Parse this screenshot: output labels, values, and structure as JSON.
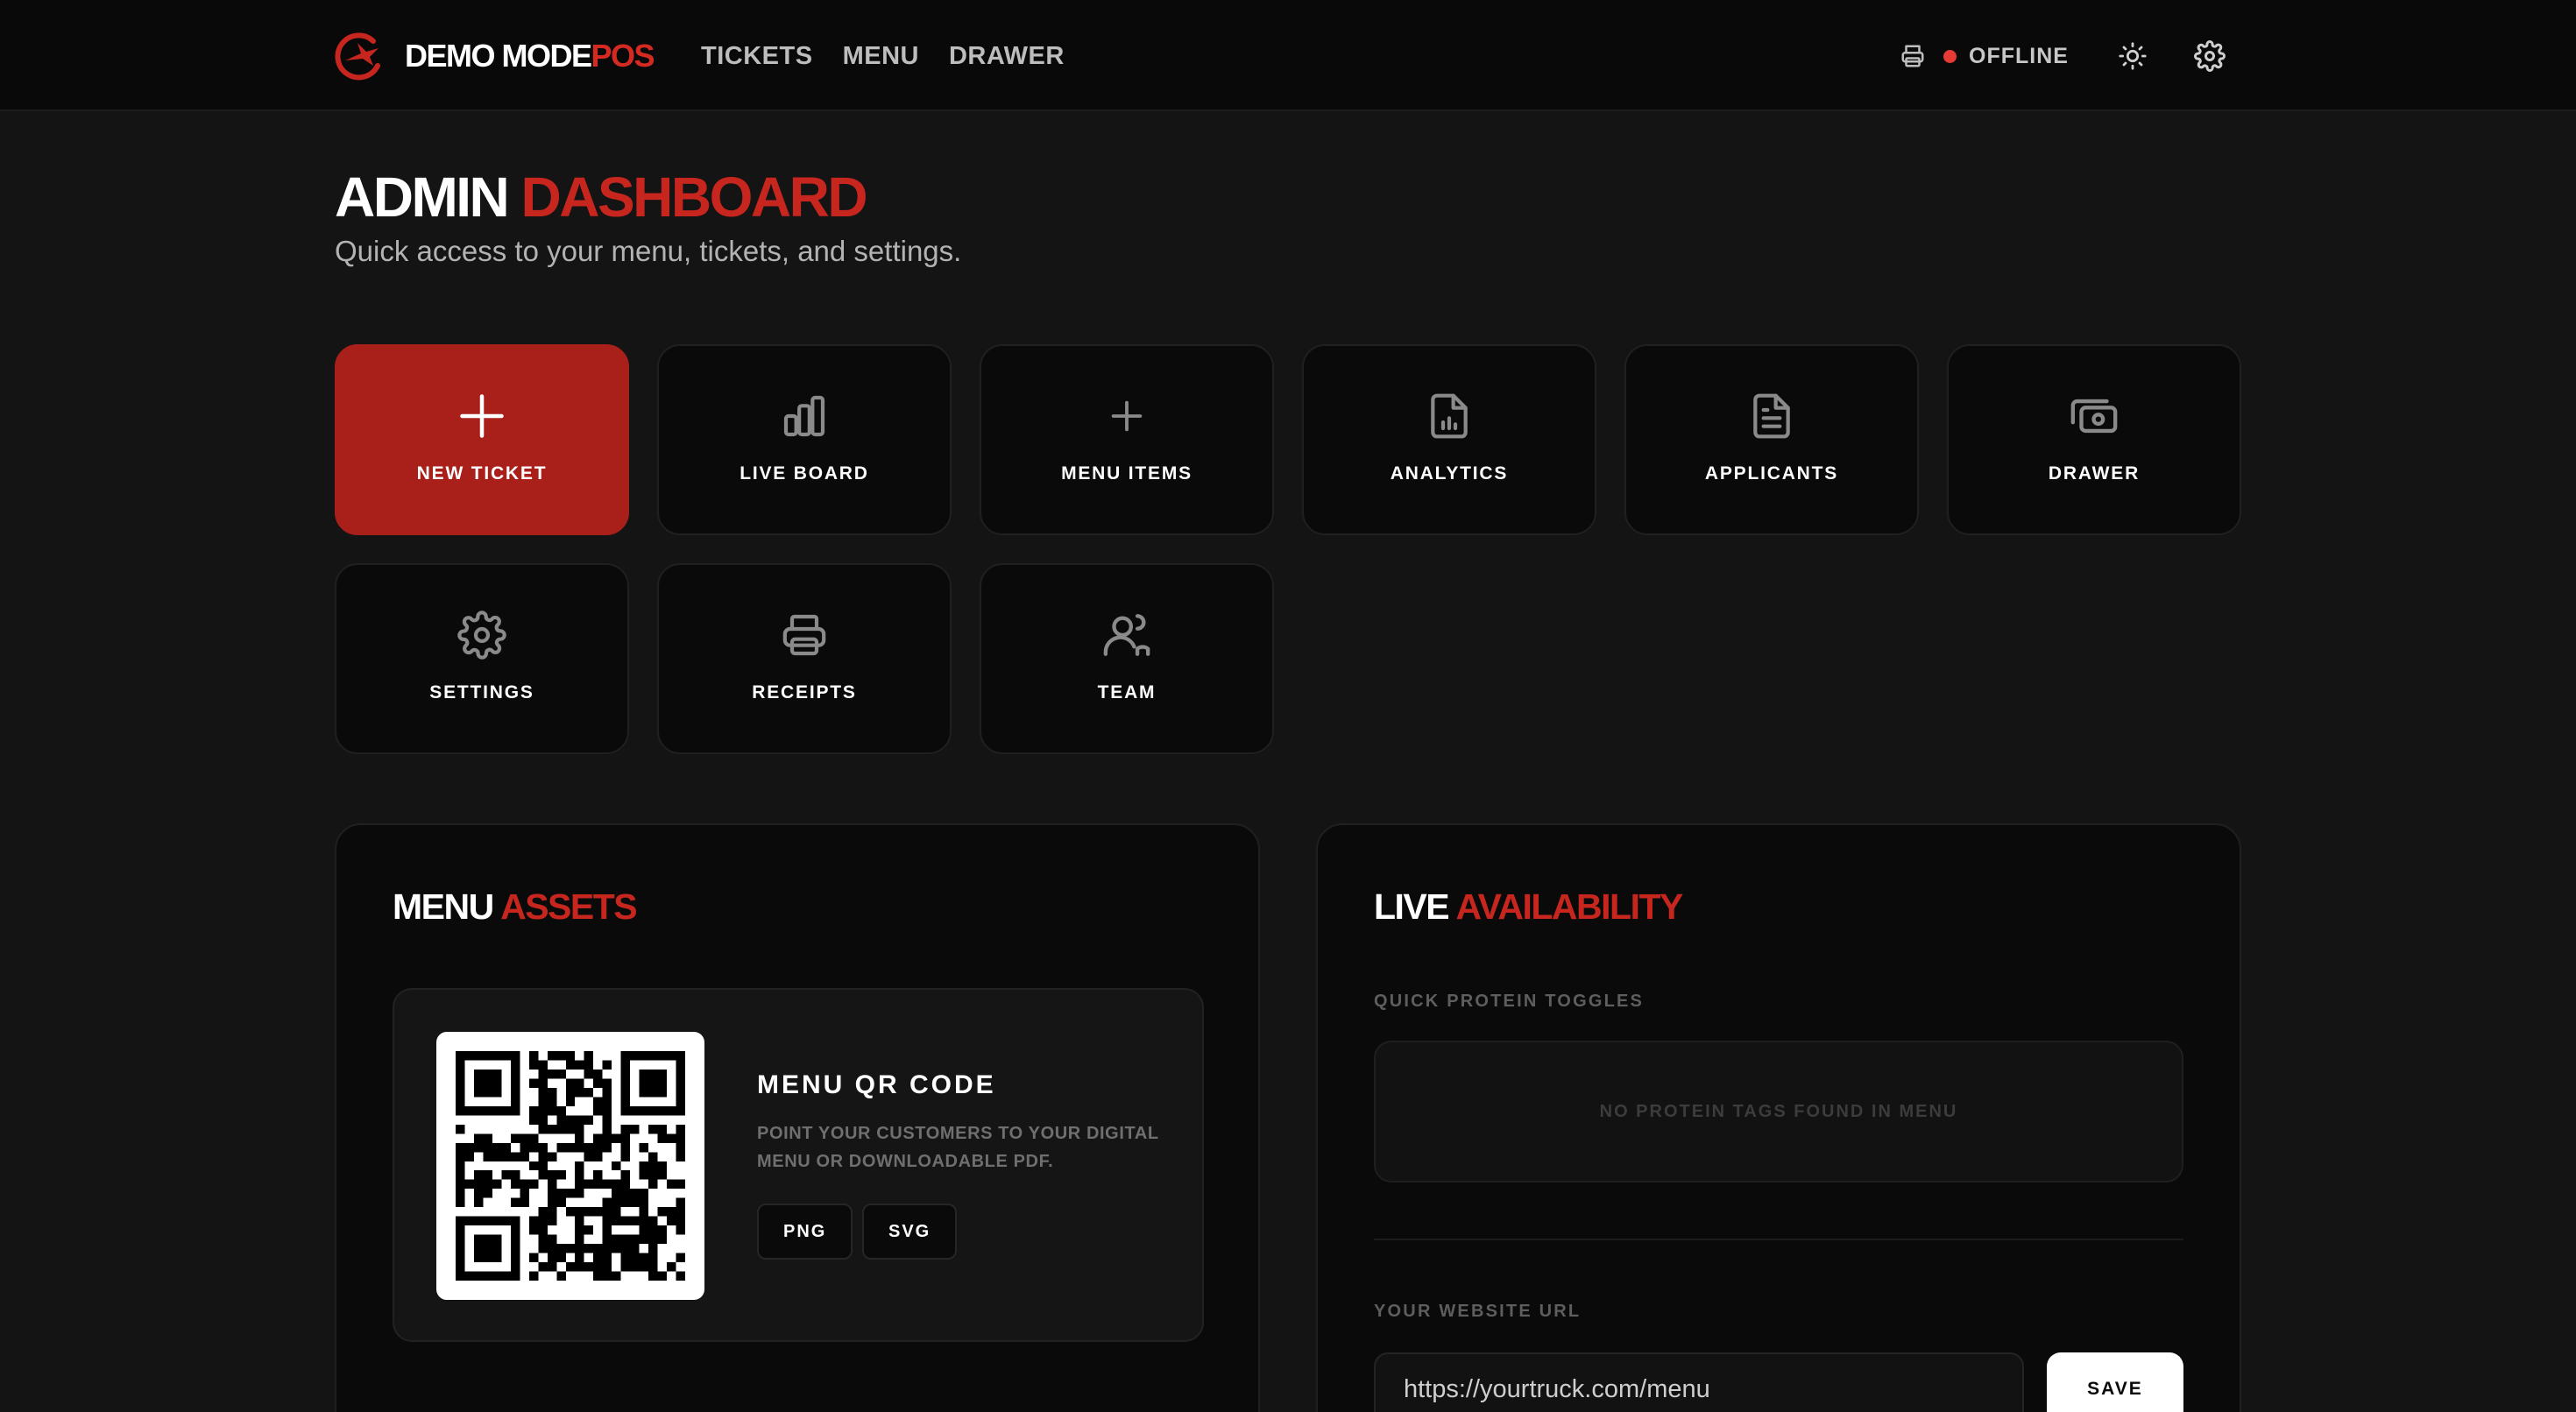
{
  "brand": {
    "name_primary": "DEMO MODE",
    "name_accent": "POS"
  },
  "nav": {
    "items": [
      {
        "label": "TICKETS"
      },
      {
        "label": "MENU"
      },
      {
        "label": "DRAWER"
      }
    ]
  },
  "status": {
    "label": "OFFLINE",
    "state": "offline",
    "dot_color": "#e53b34"
  },
  "header_icons": [
    "printer-icon",
    "sun-icon",
    "gear-icon"
  ],
  "page": {
    "title_primary": "ADMIN",
    "title_accent": "DASHBOARD",
    "subtitle": "Quick access to your menu, tickets, and settings."
  },
  "tiles": [
    {
      "label": "NEW TICKET",
      "icon": "plus-icon",
      "primary": true
    },
    {
      "label": "LIVE BOARD",
      "icon": "bar-chart-icon"
    },
    {
      "label": "MENU ITEMS",
      "icon": "plus-icon"
    },
    {
      "label": "ANALYTICS",
      "icon": "file-chart-icon"
    },
    {
      "label": "APPLICANTS",
      "icon": "file-text-icon"
    },
    {
      "label": "DRAWER",
      "icon": "cash-icon"
    },
    {
      "label": "SETTINGS",
      "icon": "gear-icon"
    },
    {
      "label": "RECEIPTS",
      "icon": "printer-icon"
    },
    {
      "label": "TEAM",
      "icon": "users-icon"
    }
  ],
  "menu_assets": {
    "title_primary": "MENU",
    "title_accent": "ASSETS",
    "qr": {
      "title": "MENU QR CODE",
      "description": "POINT YOUR CUSTOMERS TO YOUR DIGITAL MENU OR DOWNLOADABLE PDF.",
      "png_label": "PNG",
      "svg_label": "SVG"
    }
  },
  "live_availability": {
    "title_primary": "LIVE",
    "title_accent": "AVAILABILITY",
    "protein_label": "QUICK PROTEIN TOGGLES",
    "protein_empty": "NO PROTEIN TAGS FOUND IN MENU",
    "website_label": "YOUR WEBSITE URL",
    "website_placeholder": "https://yourtruck.com/menu",
    "save_label": "SAVE"
  },
  "colors": {
    "accent": "#c7261f",
    "primary_tile": "#a9201a",
    "background": "#141414",
    "topbar": "#090909"
  }
}
